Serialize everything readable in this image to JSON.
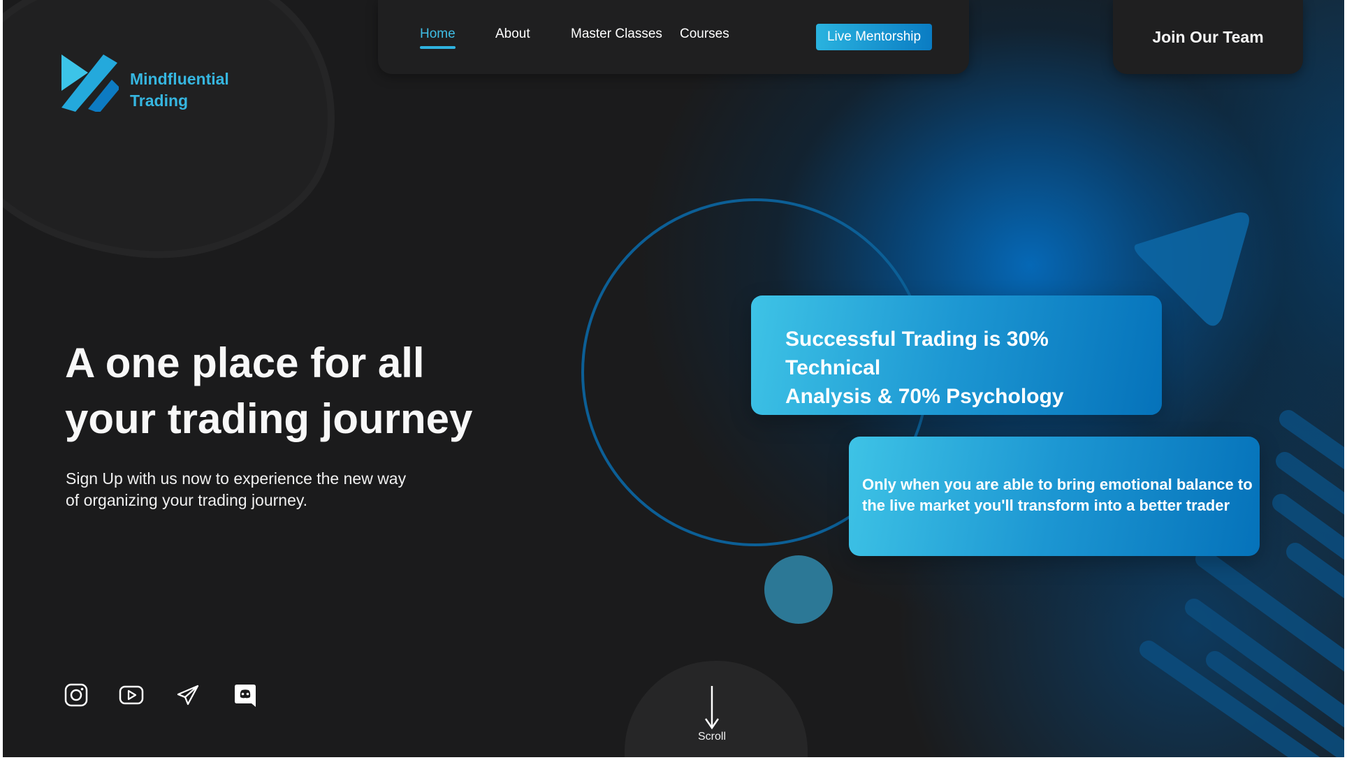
{
  "brand": {
    "name_line1": "Mindfluential",
    "name_line2": "Trading",
    "logo_icon": "mindfluential-logo-mark",
    "accent_color": "#36b6e0"
  },
  "nav": {
    "items": [
      {
        "label": "Home",
        "active": true
      },
      {
        "label": "About",
        "active": false
      },
      {
        "label": "Master Classes",
        "active": false
      },
      {
        "label": "Courses",
        "active": false
      }
    ],
    "cta_label": "Live Mentorship",
    "join_label": "Join Our Team"
  },
  "hero": {
    "title_line1": "A one place for all",
    "title_line2": "your trading journey",
    "subtitle_line1": "Sign Up with us now to experience the new way",
    "subtitle_line2": "of organizing your trading journey."
  },
  "cards": [
    {
      "text_line1": "Successful Trading is 30% Technical",
      "text_line2": "Analysis & 70% Psychology"
    },
    {
      "text_line1": "Only when you are able to bring emotional balance to",
      "text_line2": "the live market you'll transform into a better trader"
    }
  ],
  "socials": [
    {
      "icon": "instagram-icon"
    },
    {
      "icon": "youtube-icon"
    },
    {
      "icon": "telegram-icon"
    },
    {
      "icon": "discord-icon"
    }
  ],
  "scroll": {
    "label": "Scroll",
    "icon": "arrow-down-icon"
  },
  "colors": {
    "background": "#1b1b1c",
    "gradient_start": "#3ec3e6",
    "gradient_end": "#0572ba"
  }
}
